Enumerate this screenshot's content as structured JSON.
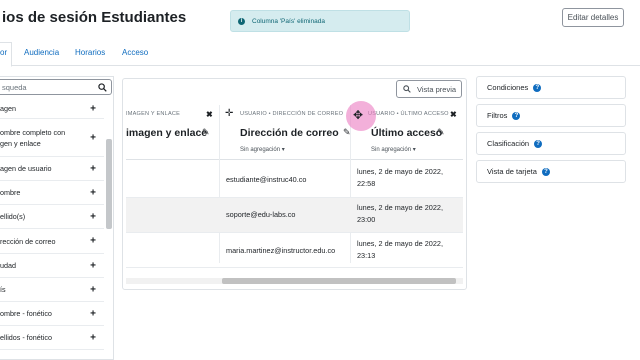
{
  "header": {
    "title": "ios de sesión Estudiantes",
    "edit_button": "Editar detalles"
  },
  "toast": {
    "message": "Columna 'País' eliminada"
  },
  "tabs": [
    {
      "label": "or",
      "active": true
    },
    {
      "label": "Audiencia",
      "active": false
    },
    {
      "label": "Horarios",
      "active": false
    },
    {
      "label": "Acceso",
      "active": false
    }
  ],
  "sidebar": {
    "search_placeholder": "squeda",
    "items": [
      {
        "label": "agen"
      },
      {
        "label": "ombre completo con\ngen y enlace"
      },
      {
        "label": "agen de usuario"
      },
      {
        "label": "ombre"
      },
      {
        "label": "ellido(s)"
      },
      {
        "label": "rección de correo"
      },
      {
        "label": "udad"
      },
      {
        "label": "ís"
      },
      {
        "label": "ombre - fonético"
      },
      {
        "label": "ellidos - fonético"
      }
    ]
  },
  "preview_button": "Vista previa",
  "columns": [
    {
      "caption": "IMAGEN Y ENLACE",
      "title": "imagen y enlace",
      "aggregation": ""
    },
    {
      "caption": "USUARIO • DIRECCIÓN DE CORREO",
      "title": "Dirección de correo",
      "aggregation": "Sin agregación"
    },
    {
      "caption": "USUARIO • ÚLTIMO ACCESO",
      "title": "Último acceso",
      "aggregation": "Sin agregación"
    }
  ],
  "rows": [
    {
      "email": "estudiante@instruc40.co",
      "date": "lunes, 2 de mayo de 2022,\n22:58"
    },
    {
      "email": "soporte@edu-labs.co",
      "date": "lunes, 2 de mayo de 2022,\n23:00"
    },
    {
      "email": "maria.martinez@instructor.edu.co",
      "date": "lunes, 2 de mayo de 2022,\n23:13"
    }
  ],
  "right_panel": {
    "sections": [
      {
        "label": "Condiciones"
      },
      {
        "label": "Filtros"
      },
      {
        "label": "Clasificación"
      },
      {
        "label": "Vista de tarjeta"
      }
    ]
  },
  "colors": {
    "link": "#0f6cbf",
    "toast_bg": "#d5ecef",
    "cursor_halo": "#ec80c4"
  }
}
